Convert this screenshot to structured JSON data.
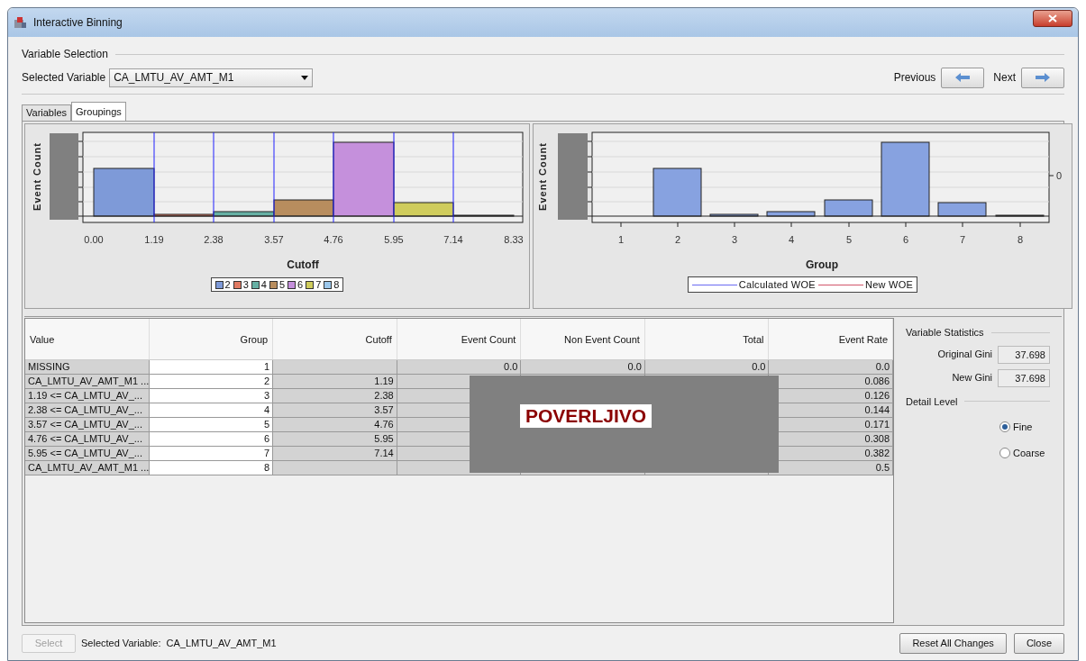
{
  "window": {
    "title": "Interactive Binning"
  },
  "variable_selection": {
    "title": "Variable Selection",
    "label": "Selected Variable",
    "value": "CA_LMTU_AV_AMT_M1",
    "previous": "Previous",
    "next": "Next"
  },
  "tabs": [
    {
      "label": "Variables",
      "selected": false
    },
    {
      "label": "Groupings",
      "selected": true
    }
  ],
  "cutoff_chart": {
    "ylabel": "Event Count",
    "xlabel": "Cutoff",
    "xticks": [
      "0.00",
      "1.19",
      "2.38",
      "3.57",
      "4.76",
      "5.95",
      "7.14",
      "8.33"
    ],
    "legend": [
      {
        "label": "2",
        "color": "#7e9ad8"
      },
      {
        "label": "3",
        "color": "#e07a63"
      },
      {
        "label": "4",
        "color": "#66b0a4"
      },
      {
        "label": "5",
        "color": "#b88d5e"
      },
      {
        "label": "6",
        "color": "#c590dc"
      },
      {
        "label": "7",
        "color": "#cfcc5c"
      },
      {
        "label": "8",
        "color": "#9cc8ec"
      }
    ]
  },
  "group_chart": {
    "ylabel": "Event Count",
    "xlabel": "Group",
    "xticks": [
      "1",
      "2",
      "3",
      "4",
      "5",
      "6",
      "7",
      "8"
    ],
    "right_tick": "0",
    "legend": [
      {
        "label": "Calculated WOE",
        "color": "#6b6bf2"
      },
      {
        "label": "New WOE",
        "color": "#d2566a"
      }
    ]
  },
  "table": {
    "columns": [
      "Value",
      "Group",
      "Cutoff",
      "Event Count",
      "Non Event Count",
      "Total",
      "Event Rate"
    ],
    "rows": [
      {
        "value": "MISSING",
        "group": "1",
        "event_count": "0.0",
        "non_event_count": "0.0",
        "total": "0.0",
        "event_rate": "0.0"
      },
      {
        "value": "CA_LMTU_AV_AMT_M1 ...",
        "group": "2",
        "cutoff": "1.19",
        "event_rate": "0.086"
      },
      {
        "value": "1.19 <= CA_LMTU_AV_...",
        "group": "3",
        "cutoff": "2.38",
        "event_rate": "0.126"
      },
      {
        "value": "2.38 <= CA_LMTU_AV_...",
        "group": "4",
        "cutoff": "3.57",
        "event_rate": "0.144"
      },
      {
        "value": "3.57 <= CA_LMTU_AV_...",
        "group": "5",
        "cutoff": "4.76",
        "event_rate": "0.171"
      },
      {
        "value": "4.76 <= CA_LMTU_AV_...",
        "group": "6",
        "cutoff": "5.95",
        "event_rate": "0.308"
      },
      {
        "value": "5.95 <= CA_LMTU_AV_...",
        "group": "7",
        "cutoff": "7.14",
        "event_rate": "0.382"
      },
      {
        "value": "CA_LMTU_AV_AMT_M1 ...",
        "group": "8",
        "event_rate": "0.5"
      }
    ]
  },
  "stamp": {
    "text": "POVERLJIVO"
  },
  "statistics": {
    "title": "Variable Statistics",
    "items": [
      {
        "label": "Original Gini",
        "value": "37.698"
      },
      {
        "label": "New Gini",
        "value": "37.698"
      }
    ]
  },
  "detail_level": {
    "title": "Detail Level",
    "options": [
      {
        "label": "Fine",
        "selected": true
      },
      {
        "label": "Coarse",
        "selected": false
      }
    ]
  },
  "footer": {
    "select_button": {
      "label": "Select",
      "disabled": true
    },
    "status": "Selected Variable:  CA_LMTU_AV_AMT_M1",
    "buttons": [
      "Reset All Changes",
      "Close"
    ]
  }
}
